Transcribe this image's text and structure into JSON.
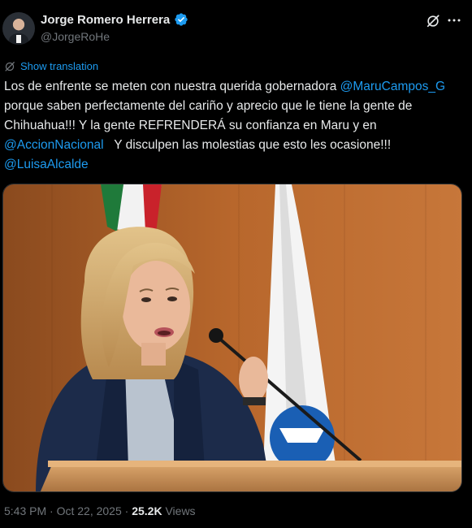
{
  "author": {
    "display_name": "Jorge Romero Herrera",
    "handle": "@JorgeRoHe",
    "verified_color": "#1d9bf0"
  },
  "header_actions": {
    "grok_icon": "grok-icon",
    "more_icon": "more-icon"
  },
  "translate": {
    "label": "Show translation",
    "icon": "translate-icon"
  },
  "tweet": {
    "t1": "Los de enfrente se meten con nuestra querida gobernadora ",
    "m1": "@MaruCampos_G",
    "t2": " porque saben perfectamente del cariño y aprecio que le tiene la gente de Chihuahua!!! Y la gente REFRENDERÁ su confianza en Maru y en ",
    "m2": "@AccionNacional",
    "t3": "   Y disculpen las molestias que esto les ocasione!!! ",
    "m3": "@LuisaAlcalde"
  },
  "meta": {
    "time": "5:43 PM",
    "sep1": " · ",
    "date": "Oct 22, 2025",
    "sep2": " · ",
    "views_count": "25.2K",
    "views_label": " Views"
  },
  "colors": {
    "background": "#000000",
    "text": "#e7e9ea",
    "secondary": "#71767b",
    "accent": "#1d9bf0"
  }
}
